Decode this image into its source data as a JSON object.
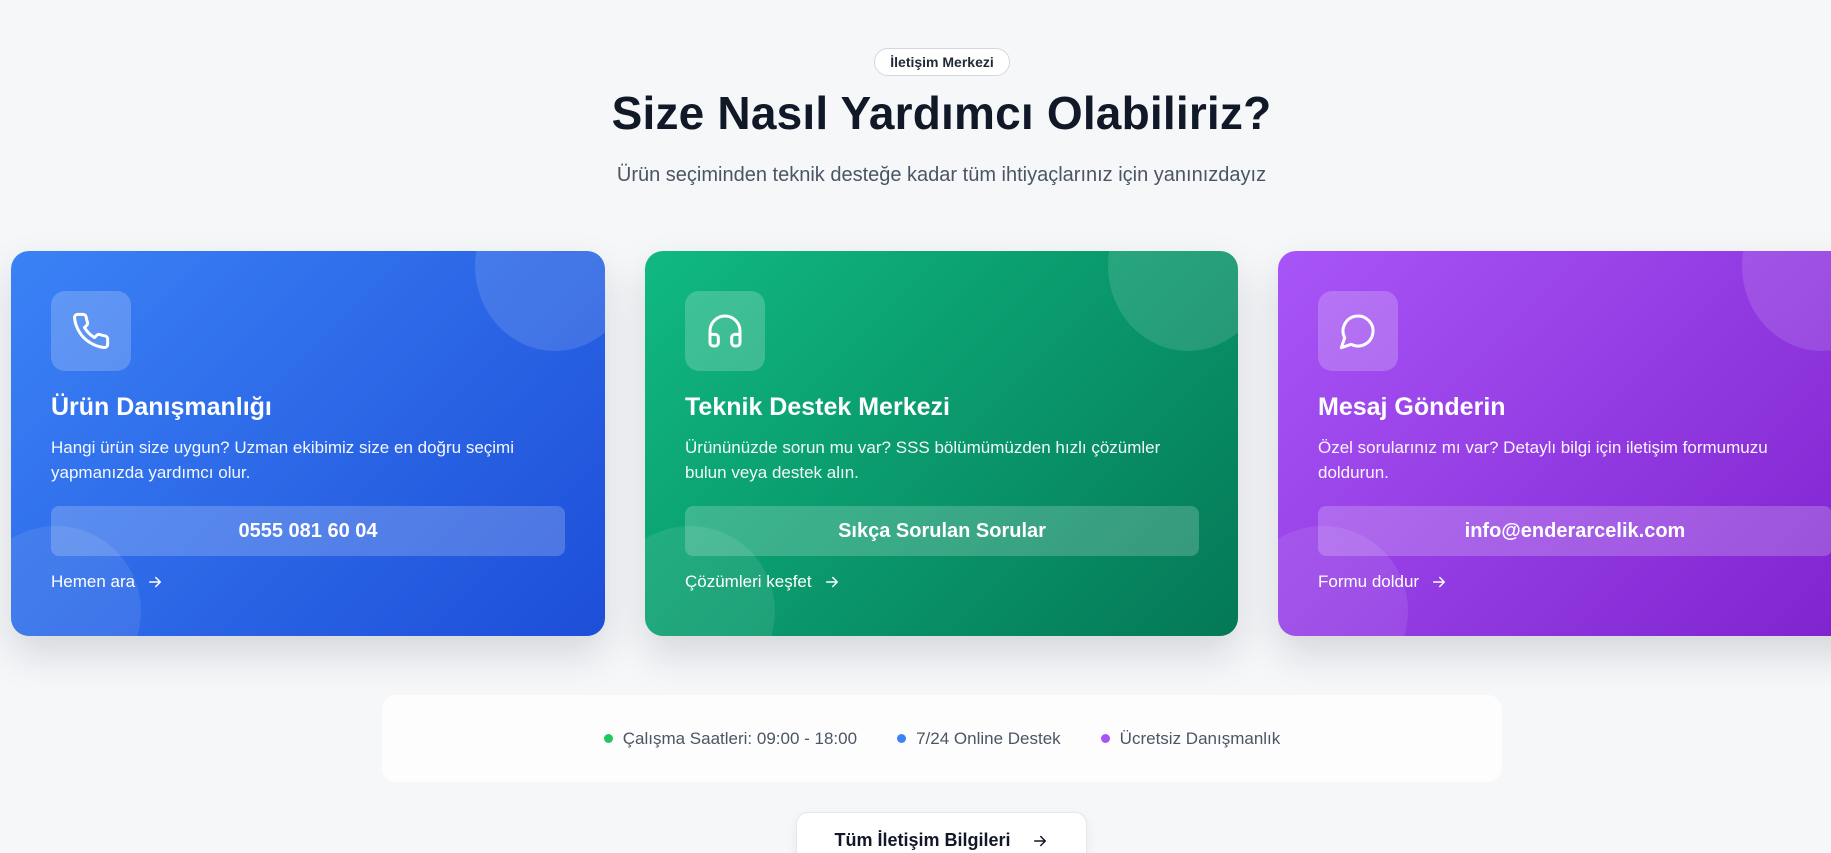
{
  "header": {
    "badge": "İletişim Merkezi",
    "title": "Size Nasıl Yardımcı Olabiliriz?",
    "subtitle": "Ürün seçiminden teknik desteğe kadar tüm ihtiyaçlarınız için yanınızdayız"
  },
  "cards": [
    {
      "icon": "phone-icon",
      "title": "Ürün Danışmanlığı",
      "description": "Hangi ürün size uygun? Uzman ekibimiz size en doğru seçimi yapmanızda yardımcı olur.",
      "button_label": "0555 081 60 04",
      "link_label": "Hemen ara",
      "color": "#2563eb"
    },
    {
      "icon": "headphones-icon",
      "title": "Teknik Destek Merkezi",
      "description": "Ürününüzde sorun mu var? SSS bölümümüzden hızlı çözümler bulun veya destek alın.",
      "button_label": "Sıkça Sorulan Sorular",
      "link_label": "Çözümleri keşfet",
      "color": "#059669"
    },
    {
      "icon": "message-circle-icon",
      "title": "Mesaj Gönderin",
      "description": "Özel sorularınız mı var? Detaylı bilgi için iletişim formumuzu doldurun.",
      "button_label": "info@enderarcelik.com",
      "link_label": "Formu doldur",
      "color": "#9333ea"
    }
  ],
  "info_bar": {
    "items": [
      {
        "label": "Çalışma Saatleri: 09:00 - 18:00",
        "dot_color": "#22c55e"
      },
      {
        "label": "7/24 Online Destek",
        "dot_color": "#3b82f6"
      },
      {
        "label": "Ücretsiz Danışmanlık",
        "dot_color": "#a855f7"
      }
    ]
  },
  "cta": {
    "label": "Tüm İletişim Bilgileri",
    "icon": "arrow-right-icon"
  }
}
